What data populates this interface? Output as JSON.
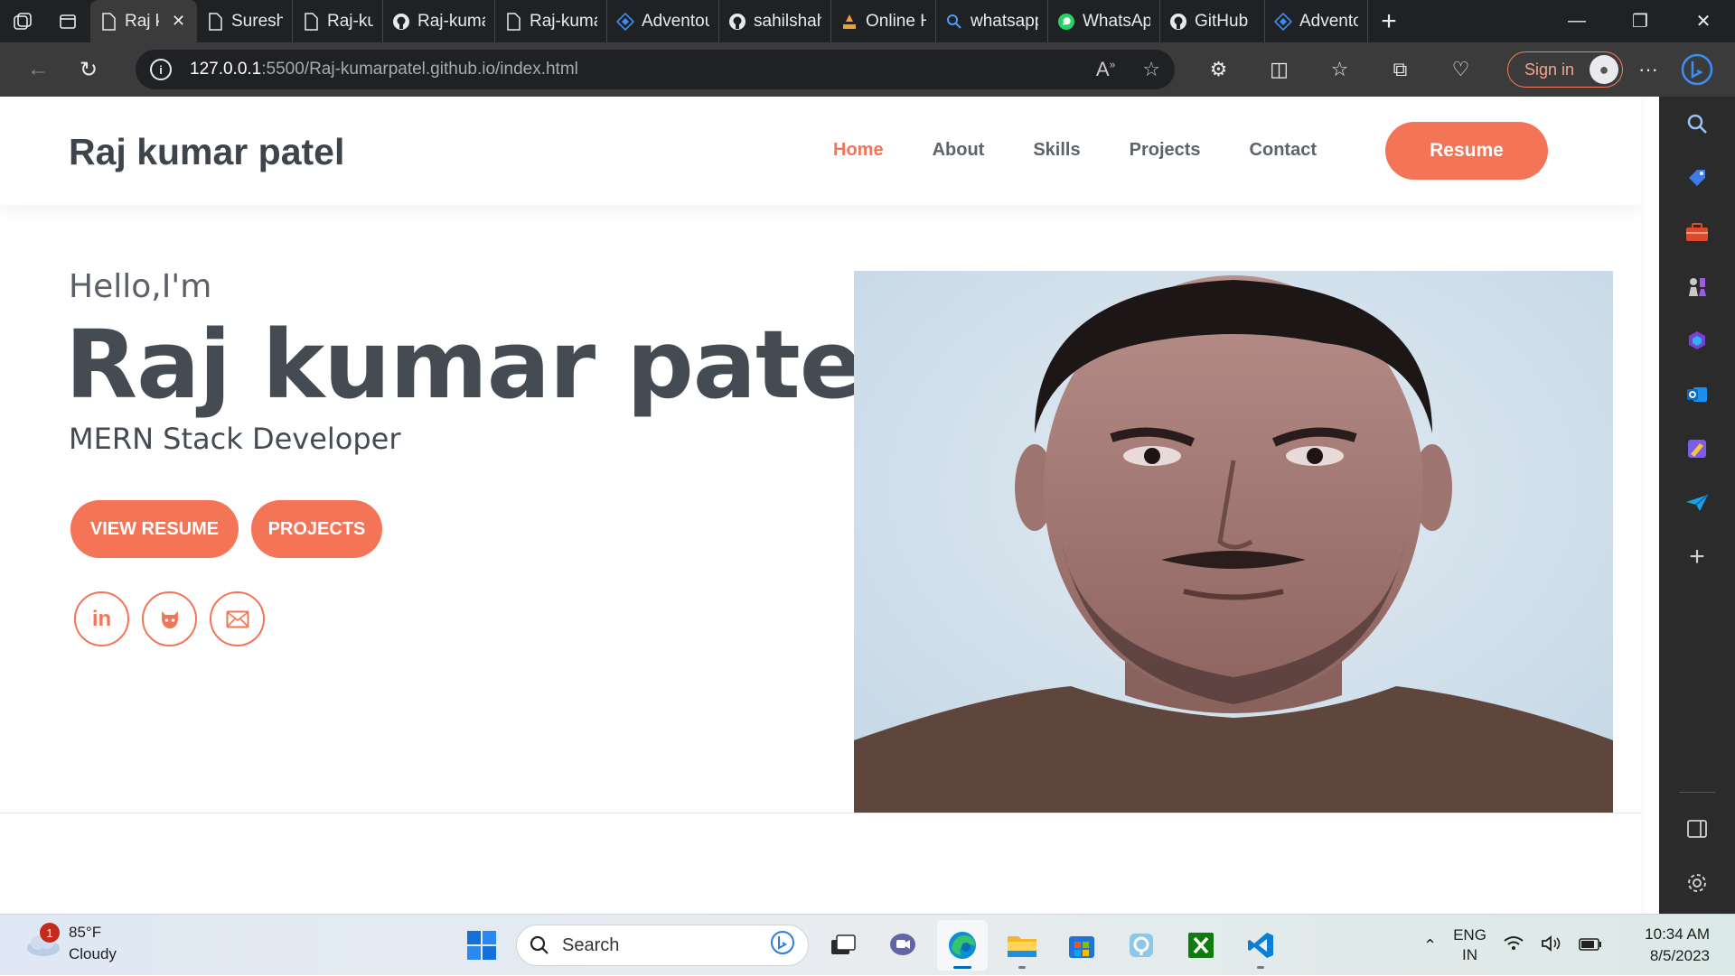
{
  "browser": {
    "tabs": [
      {
        "title": "Raj kumar patel",
        "icon": "page-icon",
        "active": true
      },
      {
        "title": "Suresh Kumar",
        "icon": "page-icon"
      },
      {
        "title": "Raj-kumarpatel",
        "icon": "page-icon"
      },
      {
        "title": "Raj-kumarpatel",
        "icon": "github-icon"
      },
      {
        "title": "Raj-kumarpatel",
        "icon": "page-icon"
      },
      {
        "title": "Adventour",
        "icon": "diamond-icon"
      },
      {
        "title": "sahilshah",
        "icon": "github-icon"
      },
      {
        "title": "Online HTML",
        "icon": "editor-icon"
      },
      {
        "title": "whatsapp",
        "icon": "search-icon"
      },
      {
        "title": "WhatsApp",
        "icon": "whatsapp-icon"
      },
      {
        "title": "GitHub",
        "icon": "github-icon"
      },
      {
        "title": "Adventour",
        "icon": "diamond-icon"
      }
    ],
    "url_host": "127.0.0.1",
    "url_path": ":5500/Raj-kumarpatel.github.io/index.html",
    "sign_in_label": "Sign in"
  },
  "site": {
    "brand": "Raj kumar patel",
    "nav": [
      "Home",
      "About",
      "Skills",
      "Projects",
      "Contact"
    ],
    "active_nav": "Home",
    "resume_label": "Resume",
    "hello": "Hello,I'm",
    "name": "Raj kumar patel",
    "role": "MERN Stack Developer",
    "view_resume_label": "VIEW RESUME",
    "projects_label": "PROJECTS",
    "social": [
      "linkedin-icon",
      "github-icon",
      "mail-icon"
    ],
    "accent_color": "#f47458",
    "text_color": "#444b53"
  },
  "taskbar": {
    "weather_temp": "85°F",
    "weather_desc": "Cloudy",
    "weather_badge": "1",
    "search_placeholder": "Search",
    "lang_line1": "ENG",
    "lang_line2": "IN",
    "time": "10:34 AM",
    "date": "8/5/2023"
  }
}
